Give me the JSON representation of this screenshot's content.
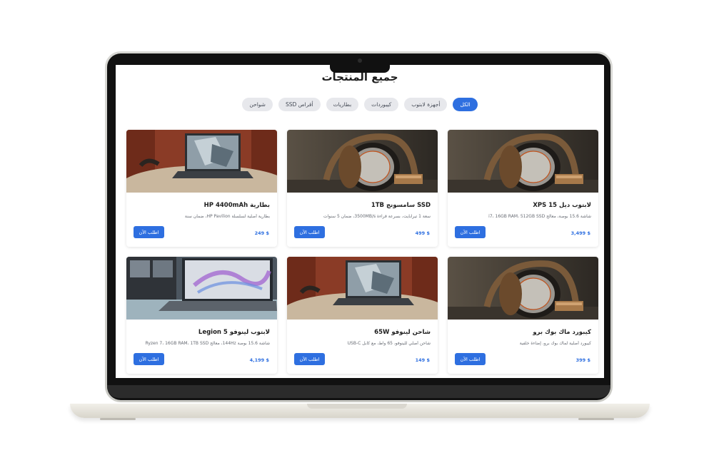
{
  "page": {
    "title": "جميع المنتجات"
  },
  "filters": [
    {
      "label": "الكل",
      "active": true
    },
    {
      "label": "أجهزة لابتوب",
      "active": false
    },
    {
      "label": "كيبوردات",
      "active": false
    },
    {
      "label": "بطاريات",
      "active": false
    },
    {
      "label": "أقراص SSD",
      "active": false
    },
    {
      "label": "شواحن",
      "active": false
    }
  ],
  "products": [
    {
      "title": "لابتوب ديل XPS 15",
      "description": "شاشة 15.6 بوصة، معالج i7، 16GB RAM، 512GB SSD",
      "price": "$ 3,499",
      "button": "اطلب الآن",
      "image": "headphones-photo"
    },
    {
      "title": "SSD سامسونج 1TB",
      "description": "سعة 1 تيرابايت، بسرعة قراءة 3500MB/s، ضمان 5 سنوات",
      "price": "$ 499",
      "button": "اطلب الآن",
      "image": "headphones-photo"
    },
    {
      "title": "بطارية HP 4400mAh",
      "description": "بطارية أصلية لسلسلة HP Pavilion، ضمان سنة",
      "price": "$ 249",
      "button": "اطلب الآن",
      "image": "laptop-desk-photo"
    },
    {
      "title": "كيبورد ماك بوك برو",
      "description": "كيبورد أصلية لماك بوك برو، إضاءة خلفية",
      "price": "$ 399",
      "button": "اطلب الآن",
      "image": "headphones-photo"
    },
    {
      "title": "شاحن لينوفو 65W",
      "description": "شاحن أصلي للينوفو، 65 واط، مع كابل USB-C",
      "price": "$ 149",
      "button": "اطلب الآن",
      "image": "laptop-desk-photo"
    },
    {
      "title": "لابتوب لينوفو Legion 5",
      "description": "شاشة 15.6 بوصة 144Hz، معالج Ryzen 7، 16GB RAM، 1TB SSD",
      "price": "$ 4,199",
      "button": "اطلب الآن",
      "image": "laptop-window-photo"
    }
  ],
  "colors": {
    "accent": "#2e6fe0",
    "chip_bg": "#e7e8ec",
    "text": "#1d1d1d",
    "muted": "#666a72"
  }
}
